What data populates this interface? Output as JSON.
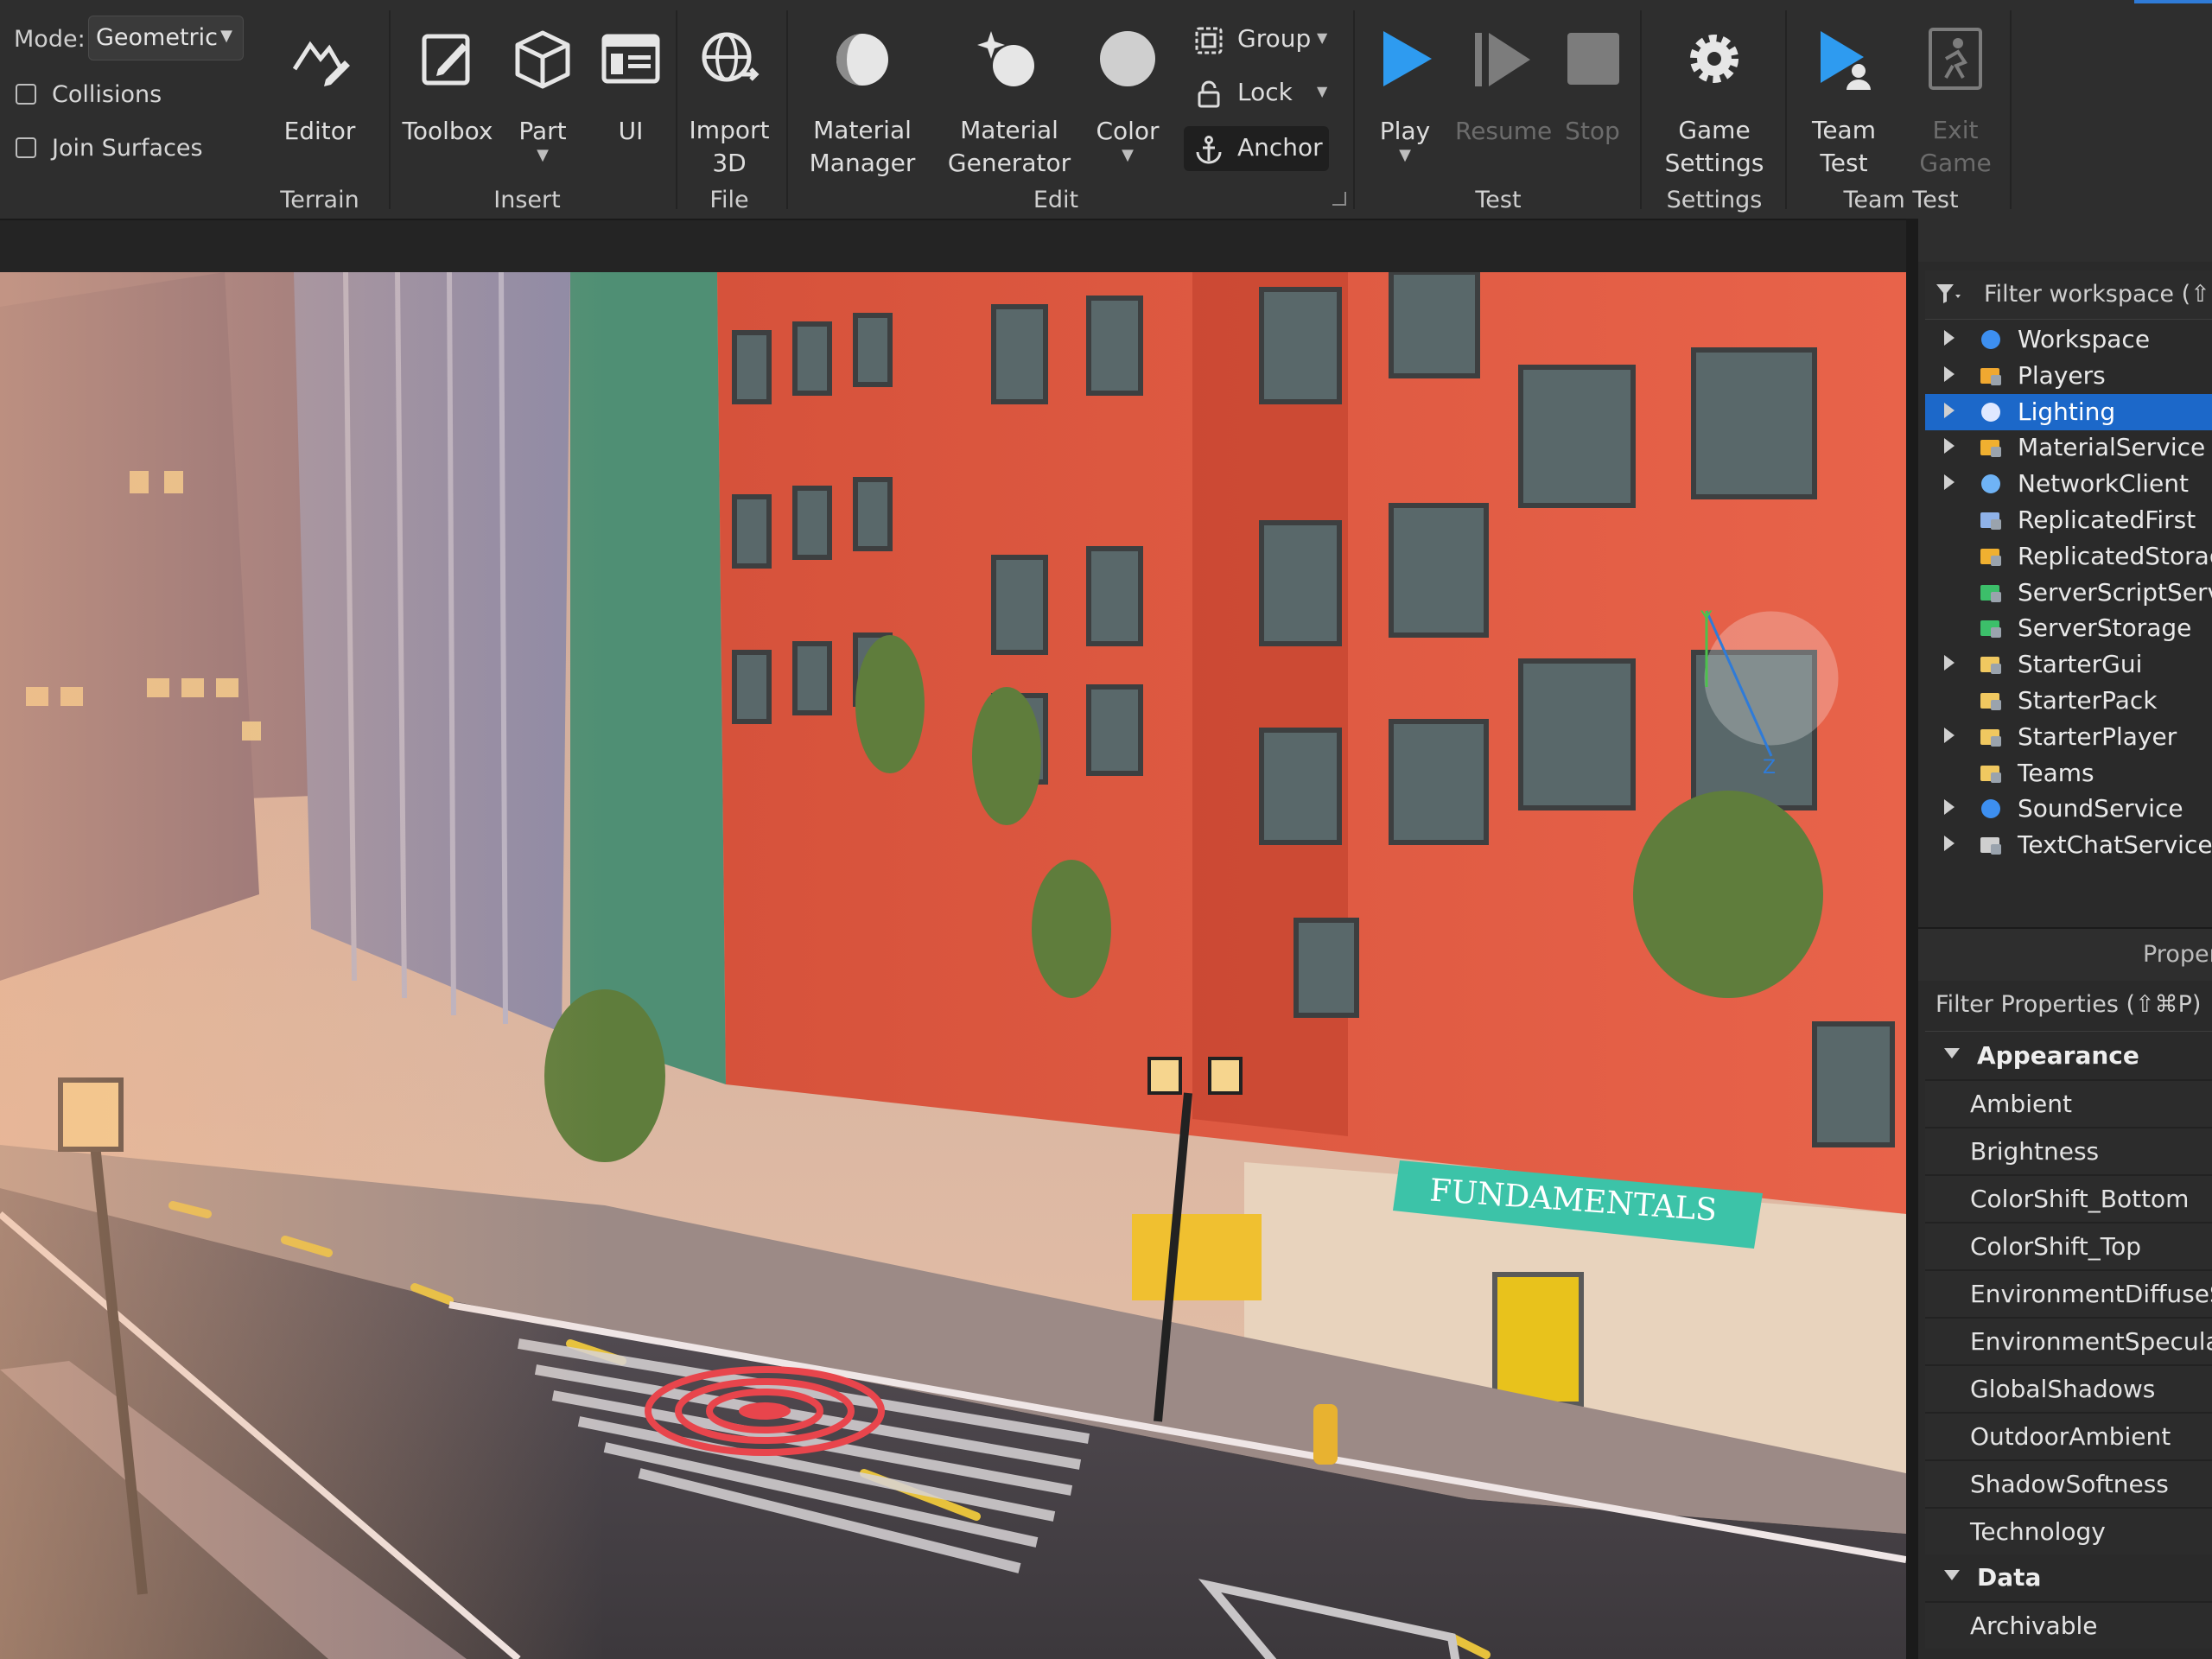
{
  "ribbon": {
    "mode_label": "Mode:",
    "mode_value": "Geometric",
    "checkboxes": [
      {
        "label": "Collisions",
        "checked": false
      },
      {
        "label": "Join Surfaces",
        "checked": false
      }
    ],
    "groups": {
      "terrain": "Terrain",
      "insert": "Insert",
      "file": "File",
      "edit": "Edit",
      "test": "Test",
      "settings": "Settings",
      "team_test": "Team Test"
    },
    "tools": {
      "editor": "Editor",
      "toolbox": "Toolbox",
      "part": "Part",
      "ui": "UI",
      "import_line1": "Import",
      "import_line2": "3D",
      "material_manager_line1": "Material",
      "material_manager_line2": "Manager",
      "material_generator_line1": "Material",
      "material_generator_line2": "Generator",
      "color": "Color",
      "group": "Group",
      "lock": "Lock",
      "anchor": "Anchor",
      "play": "Play",
      "resume": "Resume",
      "stop": "Stop",
      "game_settings_line1": "Game",
      "game_settings_line2": "Settings",
      "team_test_line1": "Team",
      "team_test_line2": "Test",
      "exit_game_line1": "Exit",
      "exit_game_line2": "Game"
    },
    "accent_color": "#2f7bd8",
    "play_color": "#2e9bf0"
  },
  "viewport": {
    "sign_text": "FUNDAMENTALS",
    "gizmo_labels": [
      "Y",
      "Z"
    ]
  },
  "explorer": {
    "filter_placeholder": "Filter workspace (⇧⌘",
    "items": [
      {
        "label": "Workspace",
        "icon": "globe-icon",
        "expandable": true,
        "selected": false
      },
      {
        "label": "Players",
        "icon": "players-icon",
        "expandable": true,
        "selected": false
      },
      {
        "label": "Lighting",
        "icon": "lightbulb-icon",
        "expandable": true,
        "selected": true
      },
      {
        "label": "MaterialService",
        "icon": "material-service-icon",
        "expandable": true,
        "selected": false
      },
      {
        "label": "NetworkClient",
        "icon": "network-icon",
        "expandable": true,
        "selected": false
      },
      {
        "label": "ReplicatedFirst",
        "icon": "replicated-first-icon",
        "expandable": false,
        "selected": false
      },
      {
        "label": "ReplicatedStorage",
        "icon": "replicated-storage-icon",
        "expandable": false,
        "selected": false
      },
      {
        "label": "ServerScriptService",
        "icon": "server-script-icon",
        "expandable": false,
        "selected": false
      },
      {
        "label": "ServerStorage",
        "icon": "server-storage-icon",
        "expandable": false,
        "selected": false
      },
      {
        "label": "StarterGui",
        "icon": "starter-gui-icon",
        "expandable": true,
        "selected": false
      },
      {
        "label": "StarterPack",
        "icon": "starter-pack-icon",
        "expandable": false,
        "selected": false
      },
      {
        "label": "StarterPlayer",
        "icon": "starter-player-icon",
        "expandable": true,
        "selected": false
      },
      {
        "label": "Teams",
        "icon": "teams-icon",
        "expandable": false,
        "selected": false
      },
      {
        "label": "SoundService",
        "icon": "sound-icon",
        "expandable": true,
        "selected": false
      },
      {
        "label": "TextChatService",
        "icon": "text-chat-icon",
        "expandable": true,
        "selected": false
      }
    ],
    "selected_color": "#1c68c9"
  },
  "properties": {
    "title": "Properties",
    "filter_placeholder": "Filter Properties (⇧⌘P)",
    "sections": [
      {
        "name": "Appearance",
        "rows": [
          "Ambient",
          "Brightness",
          "ColorShift_Bottom",
          "ColorShift_Top",
          "EnvironmentDiffuseScale",
          "EnvironmentSpecularScale",
          "GlobalShadows",
          "OutdoorAmbient",
          "ShadowSoftness",
          "Technology"
        ]
      },
      {
        "name": "Data",
        "rows": [
          "Archivable"
        ]
      }
    ]
  }
}
